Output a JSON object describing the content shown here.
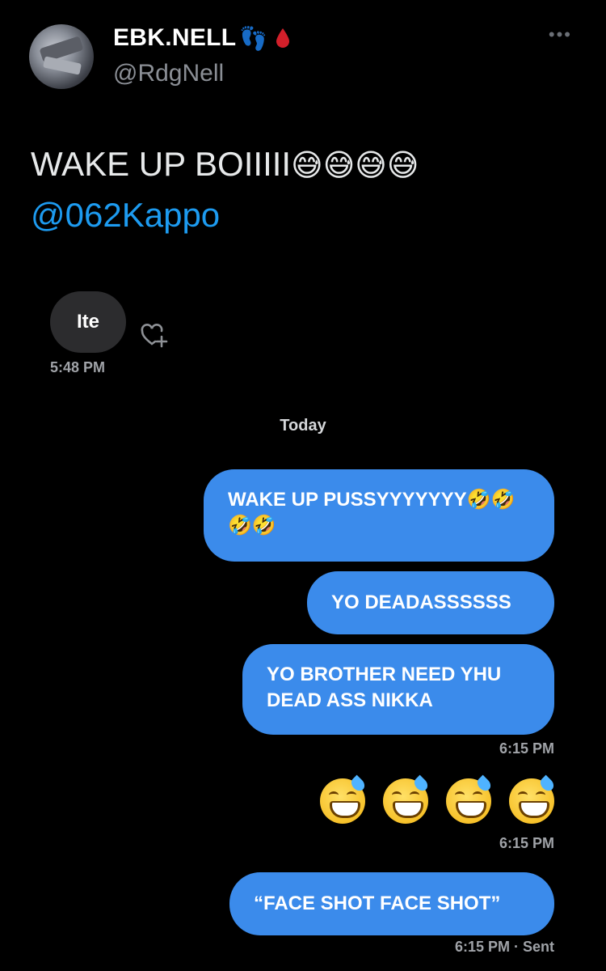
{
  "tweet": {
    "display_name": "EBK.NELL",
    "name_emojis": [
      "👣",
      "🩸"
    ],
    "handle": "@RdgNell",
    "text_main": "WAKE UP BOIIIII",
    "text_emojis": "😅😅😅😅",
    "mention": "@062Kappo",
    "more_icon": "more-dots-icon"
  },
  "dm": {
    "incoming": {
      "text": "Ite",
      "time": "5:48 PM"
    },
    "day_label": "Today",
    "outgoing": [
      {
        "text": "WAKE UP PUSSYYYYYYY🤣🤣🤣🤣"
      },
      {
        "text": "YO DEADASSSSSS"
      },
      {
        "text": "YO BROTHER NEED YHU DEAD ASS NIKKA"
      }
    ],
    "time_1": "6:15 PM",
    "emoji_message": [
      "😅",
      "😅",
      "😅",
      "😅"
    ],
    "time_2": "6:15 PM",
    "last_message": "“FACE SHOT FACE SHOT”",
    "time_3": "6:15 PM · Sent"
  },
  "colors": {
    "background": "#000000",
    "outgoing_bubble": "#3b8beb",
    "incoming_bubble": "#2c2c2e",
    "mention": "#1d9bf0",
    "muted_text": "#8b8f96"
  }
}
